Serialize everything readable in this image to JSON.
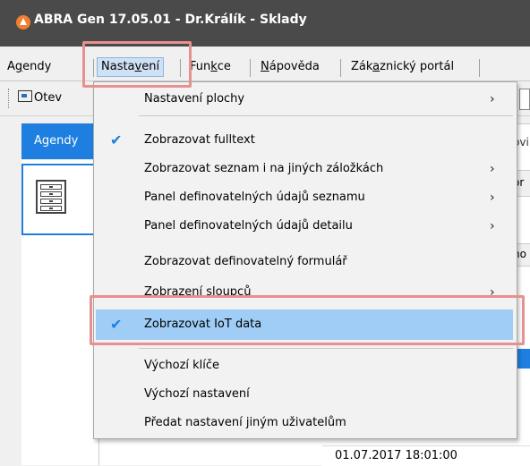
{
  "window": {
    "title": "ABRA Gen 17.05.01 - Dr.Králík - Sklady"
  },
  "menubar": {
    "items": [
      {
        "pre": "A",
        "u": "g",
        "post": "endy"
      },
      {
        "pre": "Nasta",
        "u": "v",
        "post": "ení"
      },
      {
        "pre": "Fun",
        "u": "k",
        "post": "ce"
      },
      {
        "pre": "",
        "u": "N",
        "post": "ápověda"
      },
      {
        "pre": "Zák",
        "u": "a",
        "post": "znický portál"
      }
    ]
  },
  "toolbar": {
    "open_label": "Otev"
  },
  "tabs": {
    "agendy": "Agendy",
    "edge_fragment": "ovi"
  },
  "content": {
    "fragments": [
      "or",
      "ho"
    ],
    "date": "01.07.2017 18:01:00"
  },
  "dropdown": {
    "items": [
      {
        "label": "Nastavení plochy",
        "checked": false,
        "submenu": true
      },
      {
        "label": "Zobrazovat fulltext",
        "checked": true,
        "submenu": false
      },
      {
        "label": "Zobrazovat seznam i na jiných záložkách",
        "checked": false,
        "submenu": true
      },
      {
        "label": "Panel definovatelných údajů seznamu",
        "checked": false,
        "submenu": true
      },
      {
        "label": "Panel definovatelných údajů detailu",
        "checked": false,
        "submenu": true
      },
      {
        "label": "Zobrazovat definovatelný formulář",
        "checked": false,
        "submenu": false
      },
      {
        "label": "Zobrazení sloupců",
        "checked": false,
        "submenu": true
      },
      {
        "label": "Zobrazovat IoT data",
        "checked": true,
        "submenu": false,
        "highlighted": true
      },
      {
        "label": "Výchozí klíče",
        "checked": false,
        "submenu": false
      },
      {
        "label": "Výchozí nastavení",
        "checked": false,
        "submenu": false
      },
      {
        "label": "Předat nastavení jiným uživatelům",
        "checked": false,
        "submenu": false
      }
    ],
    "check_glyph": "✔",
    "arrow_glyph": "›"
  },
  "colors": {
    "accent": "#1e7fe0",
    "highlight": "#9fcdf5",
    "callout": "#e89090",
    "titlebar": "#4a4a4a"
  }
}
